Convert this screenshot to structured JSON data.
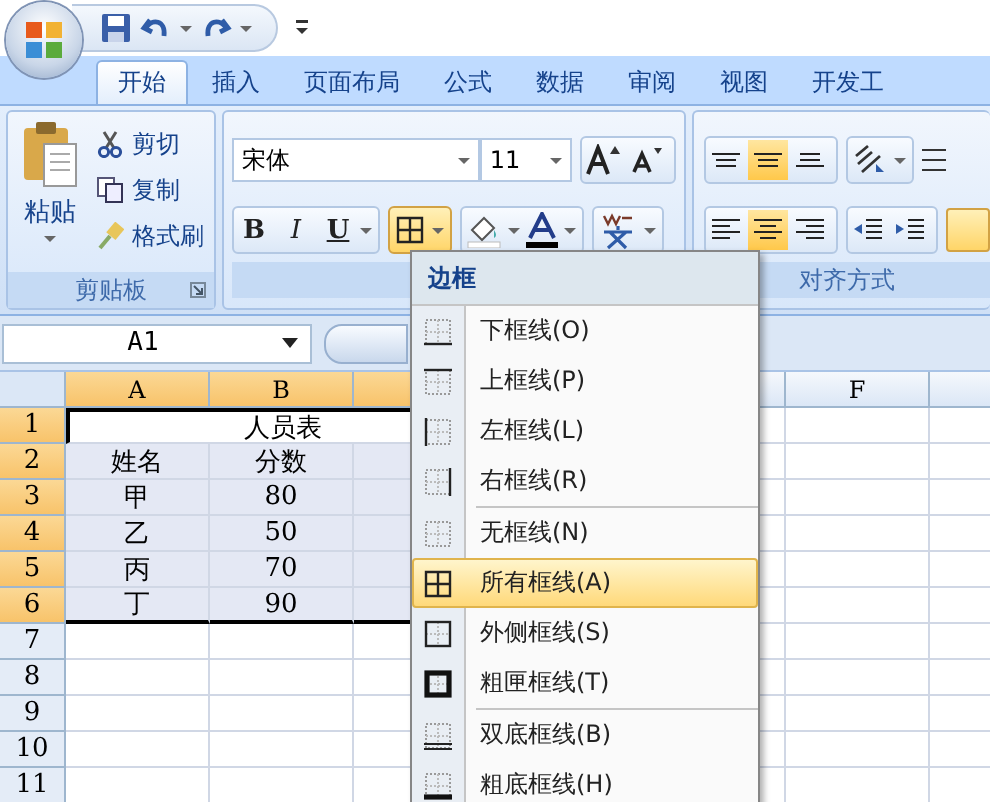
{
  "tabs": [
    {
      "label": "开始",
      "selected": true
    },
    {
      "label": "插入",
      "selected": false
    },
    {
      "label": "页面布局",
      "selected": false
    },
    {
      "label": "公式",
      "selected": false
    },
    {
      "label": "数据",
      "selected": false
    },
    {
      "label": "审阅",
      "selected": false
    },
    {
      "label": "视图",
      "selected": false
    },
    {
      "label": "开发工",
      "selected": false
    }
  ],
  "clipboard": {
    "paste": "粘贴",
    "cut": "剪切",
    "copy": "复制",
    "format_painter": "格式刷",
    "label": "剪贴板"
  },
  "font": {
    "font_name": "宋体",
    "font_size": "11",
    "bold": "B",
    "italic": "I",
    "underline": "U"
  },
  "alignment": {
    "label": "对齐方式"
  },
  "name_box": "A1",
  "columns": [
    {
      "label": "A",
      "selected": true
    },
    {
      "label": "B",
      "selected": true
    },
    {
      "selected": true
    },
    {},
    {
      "selected": false
    },
    {
      "label": "F",
      "selected": false
    },
    {
      "selected": false
    }
  ],
  "rows": [
    {
      "header": "1",
      "selected": true,
      "kind": "title",
      "cells": [
        "人员表"
      ]
    },
    {
      "header": "2",
      "selected": true,
      "kind": "data",
      "cells": [
        "姓名",
        "分数"
      ]
    },
    {
      "header": "3",
      "selected": true,
      "kind": "data",
      "cells": [
        "甲",
        "80"
      ]
    },
    {
      "header": "4",
      "selected": true,
      "kind": "data",
      "cells": [
        "乙",
        "50"
      ]
    },
    {
      "header": "5",
      "selected": true,
      "kind": "data",
      "cells": [
        "丙",
        "70"
      ]
    },
    {
      "header": "6",
      "selected": true,
      "kind": "data",
      "cells": [
        "丁",
        "90"
      ]
    },
    {
      "header": "7",
      "selected": false,
      "kind": "data",
      "cells": []
    },
    {
      "header": "8",
      "selected": false,
      "kind": "data",
      "cells": []
    },
    {
      "header": "9",
      "selected": false,
      "kind": "data",
      "cells": []
    },
    {
      "header": "10",
      "selected": false,
      "kind": "data",
      "cells": []
    },
    {
      "header": "11",
      "selected": false,
      "kind": "data",
      "cells": []
    }
  ],
  "border_menu": {
    "title": "边框",
    "items": [
      {
        "label": "下框线(O)",
        "kind": "bottom",
        "selected": false,
        "separator_before": false
      },
      {
        "label": "上框线(P)",
        "kind": "top",
        "selected": false,
        "separator_before": false
      },
      {
        "label": "左框线(L)",
        "kind": "left",
        "selected": false,
        "separator_before": false
      },
      {
        "label": "右框线(R)",
        "kind": "right",
        "selected": false,
        "separator_before": false
      },
      {
        "label": "无框线(N)",
        "kind": "none",
        "selected": false,
        "separator_before": true
      },
      {
        "label": "所有框线(A)",
        "kind": "all",
        "selected": true,
        "separator_before": false
      },
      {
        "label": "外侧框线(S)",
        "kind": "outside",
        "selected": false,
        "separator_before": false
      },
      {
        "label": "粗匣框线(T)",
        "kind": "thick_box",
        "selected": false,
        "separator_before": false
      },
      {
        "label": "双底框线(B)",
        "kind": "double_bottom",
        "selected": false,
        "separator_before": true
      },
      {
        "label": "粗底框线(H)",
        "kind": "thick_bottom",
        "selected": false,
        "separator_before": false
      }
    ]
  }
}
